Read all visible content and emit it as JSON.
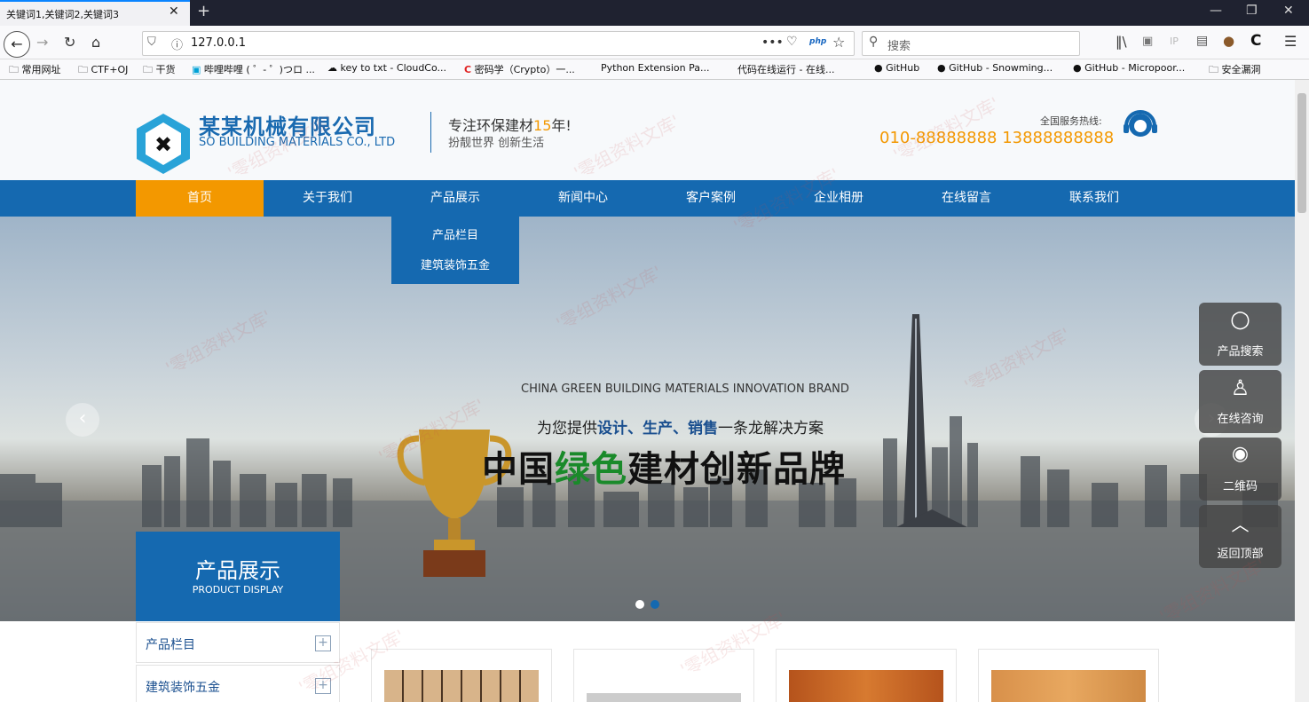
{
  "browser": {
    "tab_title": "关键词1,关键词2,关键词3",
    "url": "127.0.0.1",
    "search_placeholder": "搜索",
    "php_badge": "php",
    "bookmarks": [
      "常用网址",
      "CTF+OJ",
      "干货",
      "哔哩哔哩 ( ゜- ゜)つロ ...",
      "key to txt - CloudCo...",
      "密码学（Crypto）一...",
      "Python Extension Pa...",
      "代码在线运行 - 在线...",
      "GitHub",
      "GitHub - Snowming...",
      "GitHub - Micropoor...",
      "安全漏洞"
    ]
  },
  "header": {
    "company_cn": "某某机械有限公司",
    "company_en": "SO BUILDING MATERIALS CO., LTD",
    "slogan_prefix": "专注环保建材",
    "slogan_years": "15",
    "slogan_suffix": "年!",
    "slogan2": "扮靓世界 创新生活",
    "hotline_label": "全国服务热线:",
    "hotline": "010-88888888 13888888888"
  },
  "menu": [
    "首页",
    "关于我们",
    "产品展示",
    "新闻中心",
    "客户案例",
    "企业相册",
    "在线留言",
    "联系我们"
  ],
  "dropdown": [
    "产品栏目",
    "建筑装饰五金"
  ],
  "banner": {
    "en": "CHINA GREEN BUILDING MATERIALS INNOVATION BRAND",
    "sub_a": "为您提供",
    "sub_b": "设计、生产、销售",
    "sub_c": "一条龙解决方案",
    "main_a": "中国",
    "main_b": "绿色",
    "main_c": "建材创新品牌"
  },
  "side": [
    "产品搜索",
    "在线咨询",
    "二维码",
    "返回顶部"
  ],
  "product_panel": {
    "title_cn": "产品展示",
    "title_en": "PRODUCT DISPLAY",
    "categories": [
      "产品栏目",
      "建筑装饰五金"
    ]
  },
  "watermark": "'零组资料文库'",
  "colors": {
    "brand_blue": "#1569b0",
    "accent_orange": "#f39800",
    "green": "#1a8a2a"
  }
}
